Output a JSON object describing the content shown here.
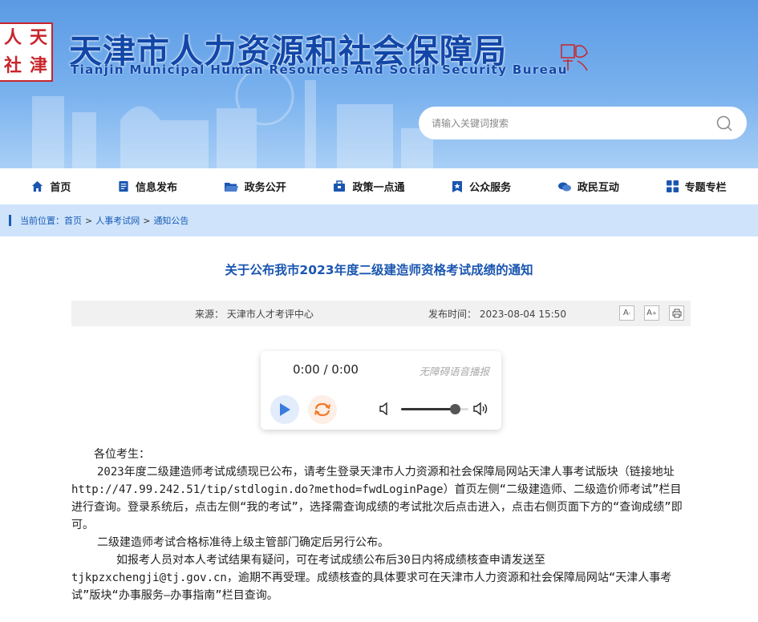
{
  "header": {
    "logo_chars": [
      "人",
      "天",
      "社",
      "津"
    ],
    "title": "天津市人力资源和社会保障局",
    "subtitle": "Tianjin Municipal Human Resources And Social Security Bureau",
    "search_placeholder": "请输入关键词搜索"
  },
  "nav": {
    "items": [
      {
        "label": "首页",
        "icon": "home-icon"
      },
      {
        "label": "信息发布",
        "icon": "document-icon"
      },
      {
        "label": "政务公开",
        "icon": "folder-icon"
      },
      {
        "label": "政策一点通",
        "icon": "briefcase-icon"
      },
      {
        "label": "公众服务",
        "icon": "star-badge-icon"
      },
      {
        "label": "政民互动",
        "icon": "chat-icon"
      },
      {
        "label": "专题专栏",
        "icon": "grid-icon"
      }
    ]
  },
  "breadcrumb": {
    "label": "当前位置：",
    "items": [
      "首页",
      "人事考试网",
      "通知公告"
    ],
    "separator": ">"
  },
  "article": {
    "title": "关于公布我市2023年度二级建造师资格考试成绩的通知",
    "source": "来源：  天津市人才考评中心",
    "publish_time": "发布时间：  2023-08-04 15:50",
    "tools": {
      "font_small": "A",
      "font_large": "A"
    }
  },
  "player": {
    "time": "0:00 / 0:00",
    "accessibility_label": "无障碍语音播报",
    "volume": 0.8
  },
  "content": {
    "greeting": "各位考生：",
    "p1": "2023年度二级建造师考试成绩现已公布，请考生登录天津市人力资源和社会保障局网站天津人事考试版块（链接地址http://47.99.242.51/tip/stdlogin.do?method=fwdLoginPage）首页左侧“二级建造师、二级造价师考试”栏目进行查询。登录系统后，点击左侧“我的考试”，选择需查询成绩的考试批次后点击进入，点击右侧页面下方的“查询成绩”即可。",
    "p2": "二级建造师考试合格标准待上级主管部门确定后另行公布。",
    "p3": "如报考人员对本人考试结果有疑问，可在考试成绩公布后30日内将成绩核查申请发送至tjkpzxchengji@tj.gov.cn，逾期不再受理。成绩核查的具体要求可在天津市人力资源和社会保障局网站“天津人事考试”版块“办事服务—办事指南”栏目查询。"
  },
  "colors": {
    "brand_blue": "#1247a8",
    "title_blue": "#1a56b0",
    "seal_red": "#c8252b",
    "crumb_bg": "#cfe4fb"
  }
}
